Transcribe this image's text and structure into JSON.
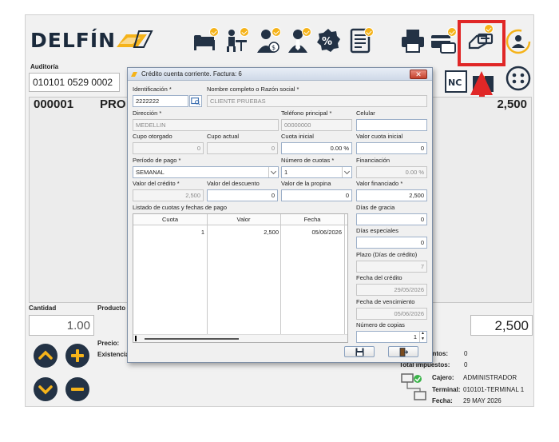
{
  "header": {
    "logo_text": "DELFÍN",
    "auditoria_label": "Auditoría",
    "auditoria_value": "010101 0529 0002"
  },
  "document": {
    "number": "000001",
    "product_header": "PRO",
    "total": "2,500"
  },
  "entry": {
    "cantidad_label": "Cantidad",
    "cantidad_value": "1.00",
    "producto_label": "Producto",
    "total_value": "2,500",
    "precio_label": "Precio:",
    "existencia_label": "Existencia:"
  },
  "summary": {
    "descuentos_label": "entos:",
    "descuentos_value": "0",
    "impuestos_label": "Total impuestos:",
    "impuestos_value": "0"
  },
  "session": {
    "cajero_label": "Cajero:",
    "cajero_value": "ADMINISTRADOR",
    "terminal_label": "Terminal:",
    "terminal_value": "010101-TERMINAL 1",
    "fecha_label": "Fecha:",
    "fecha_value": "29 MAY 2026"
  },
  "dialog": {
    "title": "Crédito cuenta corriente. Factura: 6",
    "identificacion_label": "Identificación *",
    "identificacion_value": "2222222",
    "nombre_label": "Nombre completo o Razón social *",
    "nombre_value": "CLIENTE PRUEBAS",
    "direccion_label": "Dirección *",
    "direccion_value": "MEDELLIN",
    "telefono_label": "Teléfono principal *",
    "telefono_value": "00000000",
    "celular_label": "Celular",
    "celular_value": "",
    "cupo_otorgado_label": "Cupo otorgado",
    "cupo_otorgado_value": "0",
    "cupo_actual_label": "Cupo actual",
    "cupo_actual_value": "0",
    "cuota_inicial_label": "Cuota inicial",
    "cuota_inicial_value": "0.00 %",
    "valor_cuota_inicial_label": "Valor cuota inicial",
    "valor_cuota_inicial_value": "0",
    "periodo_label": "Período de pago *",
    "periodo_value": "SEMANAL",
    "num_cuotas_label": "Número de cuotas *",
    "num_cuotas_value": "1",
    "financiacion_label": "Financiación",
    "financiacion_value": "0.00 %",
    "valor_credito_label": "Valor del crédito *",
    "valor_credito_value": "2,500",
    "valor_descuento_label": "Valor del descuento",
    "valor_descuento_value": "0",
    "valor_propina_label": "Valor de la propina",
    "valor_propina_value": "0",
    "valor_financiado_label": "Valor financiado *",
    "valor_financiado_value": "2,500",
    "listado_label": "Listado de cuotas y fechas de pago",
    "grid_headers": [
      "Cuota",
      "Valor",
      "Fecha"
    ],
    "grid_rows": [
      {
        "cuota": "1",
        "valor": "2,500",
        "fecha": "05/06/2026"
      }
    ],
    "dias_gracia_label": "Días de gracia",
    "dias_gracia_value": "0",
    "dias_especiales_label": "Días especiales",
    "dias_especiales_value": "0",
    "plazo_label": "Plazo (Días de crédito)",
    "plazo_value": "7",
    "fecha_credito_label": "Fecha del crédito",
    "fecha_credito_value": "29/05/2026",
    "fecha_venc_label": "Fecha de vencimiento",
    "fecha_venc_value": "05/06/2026",
    "copias_label": "Número de copias",
    "copias_value": "1"
  },
  "colors": {
    "highlight": "#e02727",
    "accent_orange": "#f5b31a",
    "dark_button": "#233245"
  }
}
